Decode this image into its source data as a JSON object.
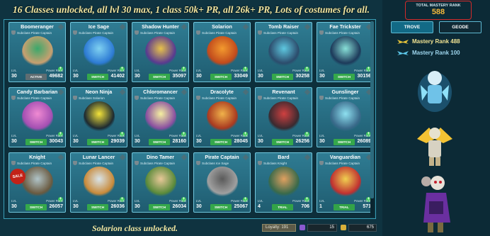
{
  "banner": "16 Classes unlocked, all lvl 30 max, 1 class 50k+ PR, all 26k+ PR, Lots of costumes for all.",
  "labels": {
    "lvl": "LVL",
    "power": "Power Rank",
    "sale": "SALE"
  },
  "cards": [
    {
      "name": "Boomeranger",
      "sub": "Subclass Pirate Captain",
      "lvl": "30",
      "btn": "ACTIVE",
      "btn_type": "active",
      "pr": "49682",
      "c1": "#3aa86b",
      "c2": "#c8a070"
    },
    {
      "name": "Ice Sage",
      "sub": "Subclass Pirate Captain",
      "lvl": "30",
      "btn": "SWITCH",
      "btn_type": "switch",
      "pr": "41402",
      "c1": "#7fd1f1",
      "c2": "#2d7bd4"
    },
    {
      "name": "Shadow Hunter",
      "sub": "Subclass Pirate Captain",
      "lvl": "30",
      "btn": "SWITCH",
      "btn_type": "switch",
      "pr": "35097",
      "c1": "#e7c24a",
      "c2": "#5a3a90"
    },
    {
      "name": "Solarion",
      "sub": "Subclass Pirate Captain",
      "lvl": "30",
      "btn": "SWITCH",
      "btn_type": "switch",
      "pr": "33049",
      "c1": "#f39a2e",
      "c2": "#c14a1c"
    },
    {
      "name": "Tomb Raiser",
      "sub": "Subclass Pirate Captain",
      "lvl": "30",
      "btn": "SWITCH",
      "btn_type": "switch",
      "pr": "30258",
      "c1": "#5ec8e0",
      "c2": "#2c4c6c"
    },
    {
      "name": "Fae Trickster",
      "sub": "Subclass Pirate Captain",
      "lvl": "30",
      "btn": "SWITCH",
      "btn_type": "switch",
      "pr": "30156",
      "c1": "#88e0d8",
      "c2": "#1d3a5a"
    },
    {
      "name": "Candy Barbarian",
      "sub": "Subclass Pirate Captain",
      "lvl": "30",
      "btn": "SWITCH",
      "btn_type": "switch",
      "pr": "30043",
      "c1": "#f08ad2",
      "c2": "#a34fb2"
    },
    {
      "name": "Neon Ninja",
      "sub": "Subclass Solarion",
      "lvl": "30",
      "btn": "SWITCH",
      "btn_type": "switch",
      "pr": "29039",
      "c1": "#f4e43a",
      "c2": "#1e2a30"
    },
    {
      "name": "Chloromancer",
      "sub": "Subclass Pirate Captain",
      "lvl": "30",
      "btn": "SWITCH",
      "btn_type": "switch",
      "pr": "28160",
      "c1": "#f5f0a0",
      "c2": "#8a4fa0"
    },
    {
      "name": "Dracolyte",
      "sub": "Subclass Pirate Captain",
      "lvl": "30",
      "btn": "SWITCH",
      "btn_type": "switch",
      "pr": "28045",
      "c1": "#f0b24a",
      "c2": "#a93a20"
    },
    {
      "name": "Revenant",
      "sub": "Subclass Pirate Captain",
      "lvl": "30",
      "btn": "SWITCH",
      "btn_type": "switch",
      "pr": "26256",
      "c1": "#d04040",
      "c2": "#3a2a30"
    },
    {
      "name": "Gunslinger",
      "sub": "Subclass Pirate Captain",
      "lvl": "30",
      "btn": "SWITCH",
      "btn_type": "switch",
      "pr": "26089",
      "c1": "#8ee0f0",
      "c2": "#3a6a8a"
    },
    {
      "name": "Knight",
      "sub": "Subclass Pirate Captain",
      "lvl": "30",
      "btn": "SWITCH",
      "btn_type": "switch",
      "pr": "26057",
      "c1": "#b0c4c8",
      "c2": "#6a5a40",
      "sale": true
    },
    {
      "name": "Lunar Lancer",
      "sub": "Subclass Pirate Captain",
      "lvl": "30",
      "btn": "SWITCH",
      "btn_type": "switch",
      "pr": "26036",
      "c1": "#d8e4ea",
      "c2": "#c88a3a"
    },
    {
      "name": "Dino Tamer",
      "sub": "Subclass Pirate Captain",
      "lvl": "30",
      "btn": "SWITCH",
      "btn_type": "switch",
      "pr": "26034",
      "c1": "#e8c898",
      "c2": "#5a8a3a"
    },
    {
      "name": "Pirate Captain",
      "sub": "Subclass Ice Sage",
      "lvl": "30",
      "btn": "SWITCH",
      "btn_type": "switch",
      "pr": "25067",
      "c1": "#5a5a5a",
      "c2": "#a0a0a0"
    },
    {
      "name": "Bard",
      "sub": "Subclass Knight",
      "lvl": "4",
      "btn": "TRIAL",
      "btn_type": "trial",
      "pr": "706",
      "c1": "#e0a060",
      "c2": "#3a6a4a"
    },
    {
      "name": "Vanguardian",
      "sub": "Subclass Pirate Captain",
      "lvl": "1",
      "btn": "TRIAL",
      "btn_type": "trial",
      "pr": "571",
      "c1": "#f0d050",
      "c2": "#c03030"
    }
  ],
  "footer": {
    "unlocked": "Solarion class unlocked.",
    "loyalty": "Loyalty: 191",
    "currency1": "15",
    "currency2": "675"
  },
  "sidebar": {
    "mastery_label": "TOTAL MASTERY RANK",
    "mastery_value": "588",
    "tabs": [
      "TROVE",
      "GEODE"
    ],
    "ranks": [
      "Mastery Rank 488",
      "Mastery Rank 100"
    ]
  },
  "colors": {
    "accent": "#f4b73a",
    "highlight": "#d32a2a"
  }
}
